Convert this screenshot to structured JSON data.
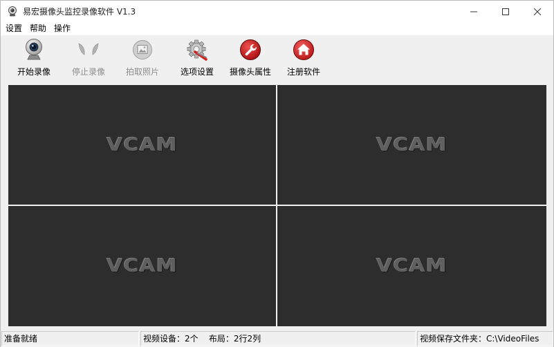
{
  "window": {
    "title": "易宏摄像头监控录像软件 V1.3"
  },
  "menu": [
    "设置",
    "帮助",
    "操作"
  ],
  "toolbar": {
    "start_record": "开始录像",
    "stop_record": "停止录像",
    "take_photo": "拍取照片",
    "options": "选项设置",
    "camera_props": "摄像头属性",
    "register": "注册软件"
  },
  "video": {
    "placeholder": "VCAM",
    "background": "#2d2d2d"
  },
  "status": {
    "ready": "准备就绪",
    "devices": "视频设备：2个",
    "layout": "布局：2行2列",
    "folder": "视频保存文件夹：C:\\VideoFiles"
  }
}
